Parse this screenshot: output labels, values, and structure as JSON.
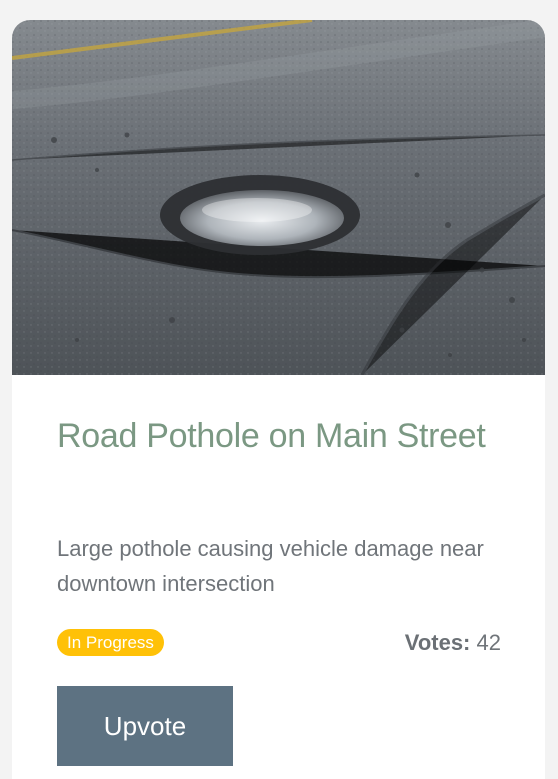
{
  "issue": {
    "title": "Road Pothole on Main Street",
    "description": "Large pothole causing vehicle damage near downtown intersection",
    "status": "In Progress",
    "votes_label": "Votes:",
    "votes_count": "42",
    "upvote_label": "Upvote"
  },
  "colors": {
    "title": "#7b9883",
    "description": "#70757a",
    "status_badge": "#ffc107",
    "upvote_button": "#5d7282",
    "button_text": "#ffffff",
    "card_background": "#ffffff",
    "page_background": "#f3f3f3"
  }
}
